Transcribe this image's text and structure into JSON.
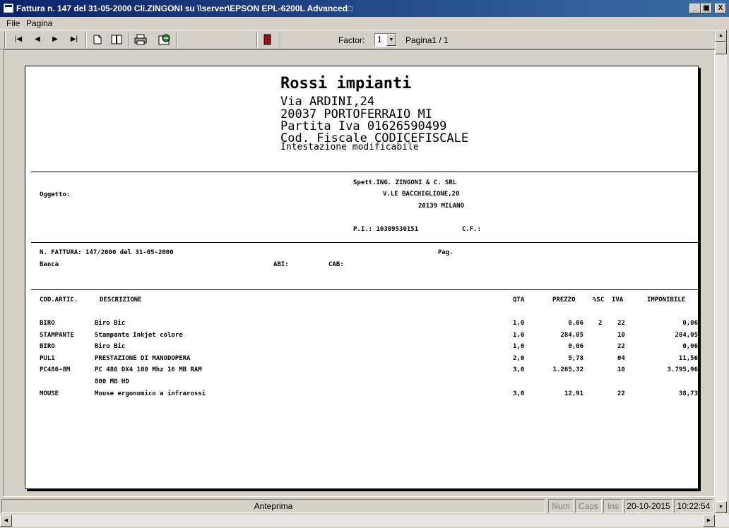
{
  "window": {
    "title": "Fattura n. 147 del 31-05-2000 Cli.ZINGONI su \\\\server\\EPSON EPL-6200L Advanced□",
    "minimize_glyph": "_",
    "maximize_glyph": "▣",
    "close_glyph": "X"
  },
  "menu": [
    "File",
    "Pagina"
  ],
  "toolbar": {
    "first_glyph": "|◀",
    "prev_glyph": "◀",
    "next_glyph": "▶",
    "last_glyph": "▶|",
    "factor_label": "Factor:",
    "factor_value": "1",
    "page_indicator": "Pagina1 / 1"
  },
  "invoice": {
    "company_name": "Rossi impianti",
    "company_address": "Via ARDINI,24",
    "company_city": "20037 PORTOFERRAIO MI",
    "company_vat": "Partita Iva  01626590499",
    "company_tax": "Cod. Fiscale  CODICEFISCALE",
    "company_header_note": "Intestazione modificabile",
    "object_label": "Oggetto:",
    "customer_name": "Spett.ING. ZINGONI & C. SRL",
    "customer_address": "V.LE BACCHIGLIONE,20",
    "customer_city": "20139 MILANO",
    "customer_piva": "P.I.: 10309530151",
    "customer_cf": "C.F.:",
    "invoice_number": "N. FATTURA:  147/2000 del 31-05-2000",
    "page_label": "Pag.",
    "bank_label": "Banca",
    "abi_label": "ABI:",
    "cab_label": "CAB:",
    "headers": {
      "code": "COD.ARTIC.",
      "description": "DESCRIZIONE",
      "qty": "QTA",
      "price": "PREZZO",
      "discount": "%SC",
      "vat": "IVA",
      "taxable": "IMPONIBILE"
    },
    "rows": [
      {
        "code": "BIRO",
        "description": "Biro Bic",
        "qty": "1,0",
        "price": "0,06",
        "discount": "2",
        "vat": "22",
        "taxable": "0,06"
      },
      {
        "code": "STAMPANTE",
        "description": "Stampante Inkjet colore",
        "qty": "1,0",
        "price": "284,05",
        "discount": "",
        "vat": "10",
        "taxable": "284,05"
      },
      {
        "code": "BIRO",
        "description": "Biro Bic",
        "qty": "1,0",
        "price": "0,06",
        "discount": "",
        "vat": "22",
        "taxable": "0,06"
      },
      {
        "code": "PUL1",
        "description": "PRESTAZIONE DI MANODOPERA",
        "qty": "2,0",
        "price": "5,78",
        "discount": "",
        "vat": "04",
        "taxable": "11,56"
      },
      {
        "code": "PC486-8M",
        "description": "PC 486 DX4 100 Mhz 16 MB RAM",
        "qty": "3,0",
        "price": "1.265,32",
        "discount": "",
        "vat": "10",
        "taxable": "3.795,96"
      },
      {
        "code": "",
        "description": "800 MB HD",
        "qty": "",
        "price": "",
        "discount": "",
        "vat": "",
        "taxable": ""
      },
      {
        "code": "MOUSE",
        "description": "Mouse ergonomico a infrarossi",
        "qty": "3,0",
        "price": "12,91",
        "discount": "",
        "vat": "22",
        "taxable": "38,73"
      }
    ]
  },
  "status": {
    "mode": "Anteprima",
    "num": "Num",
    "caps": "Caps",
    "ins": "Ins",
    "date": "20-10-2015",
    "time": "10:22:54"
  },
  "scrollbar": {
    "up_glyph": "▲",
    "down_glyph": "▼",
    "left_glyph": "◀",
    "right_glyph": "▶"
  }
}
